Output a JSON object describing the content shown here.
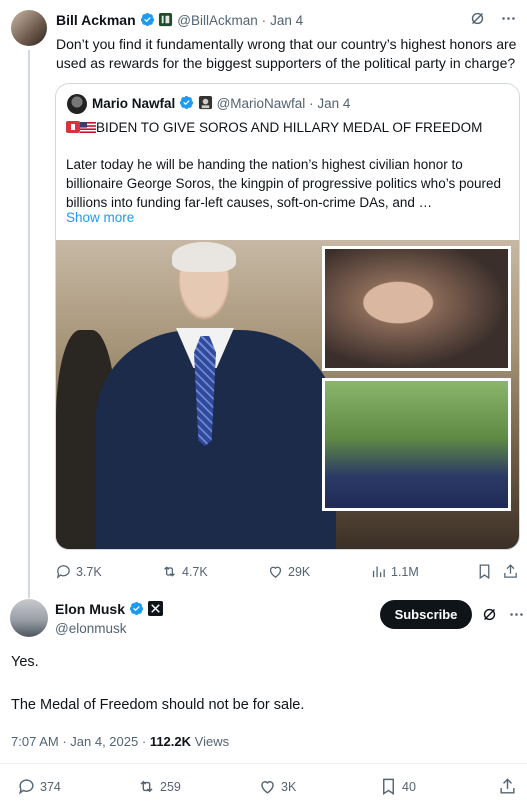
{
  "parent_tweet": {
    "author_name": "Bill Ackman",
    "handle": "@BillAckman",
    "date": "Jan 4",
    "text": "Don’t you find it fundamentally wrong that our country’s highest honors are used as rewards for the biggest supporters of the political party in charge?",
    "quoted_tweet": {
      "author_name": "Mario Nawfal",
      "handle": "@MarioNawfal",
      "date": "Jan 4",
      "headline": "BIDEN TO GIVE SOROS AND HILLARY MEDAL OF FREEDOM",
      "body": "Later today he will be handing the nation’s highest civilian honor to billionaire George Soros, the kingpin of progressive politics who’s poured billions into funding far-left causes, soft-on-crime DAs, and …",
      "show_more": "Show more"
    },
    "actions": {
      "replies": "3.7K",
      "reposts": "4.7K",
      "likes": "29K",
      "views": "1.1M"
    }
  },
  "reply_tweet": {
    "author_name": "Elon Musk",
    "handle": "@elonmusk",
    "subscribe_label": "Subscribe",
    "text_line1": "Yes.",
    "text_line2": "The Medal of Freedom should not be for sale.",
    "time": "7:07 AM",
    "date": "Jan 4, 2025",
    "views_count": "112.2K",
    "views_label": "Views",
    "actions": {
      "replies": "374",
      "reposts": "259",
      "likes": "3K",
      "bookmarks": "40"
    }
  },
  "icons": [
    "verified-badge-icon",
    "grok-icon",
    "more-icon",
    "reply-icon",
    "repost-icon",
    "like-icon",
    "views-icon",
    "bookmark-icon",
    "share-icon",
    "x-logo-icon",
    "flag-icon"
  ],
  "colors": {
    "accent": "#1d9bf0",
    "text": "#0f1419",
    "muted": "#536471",
    "border": "#cfd9de"
  }
}
